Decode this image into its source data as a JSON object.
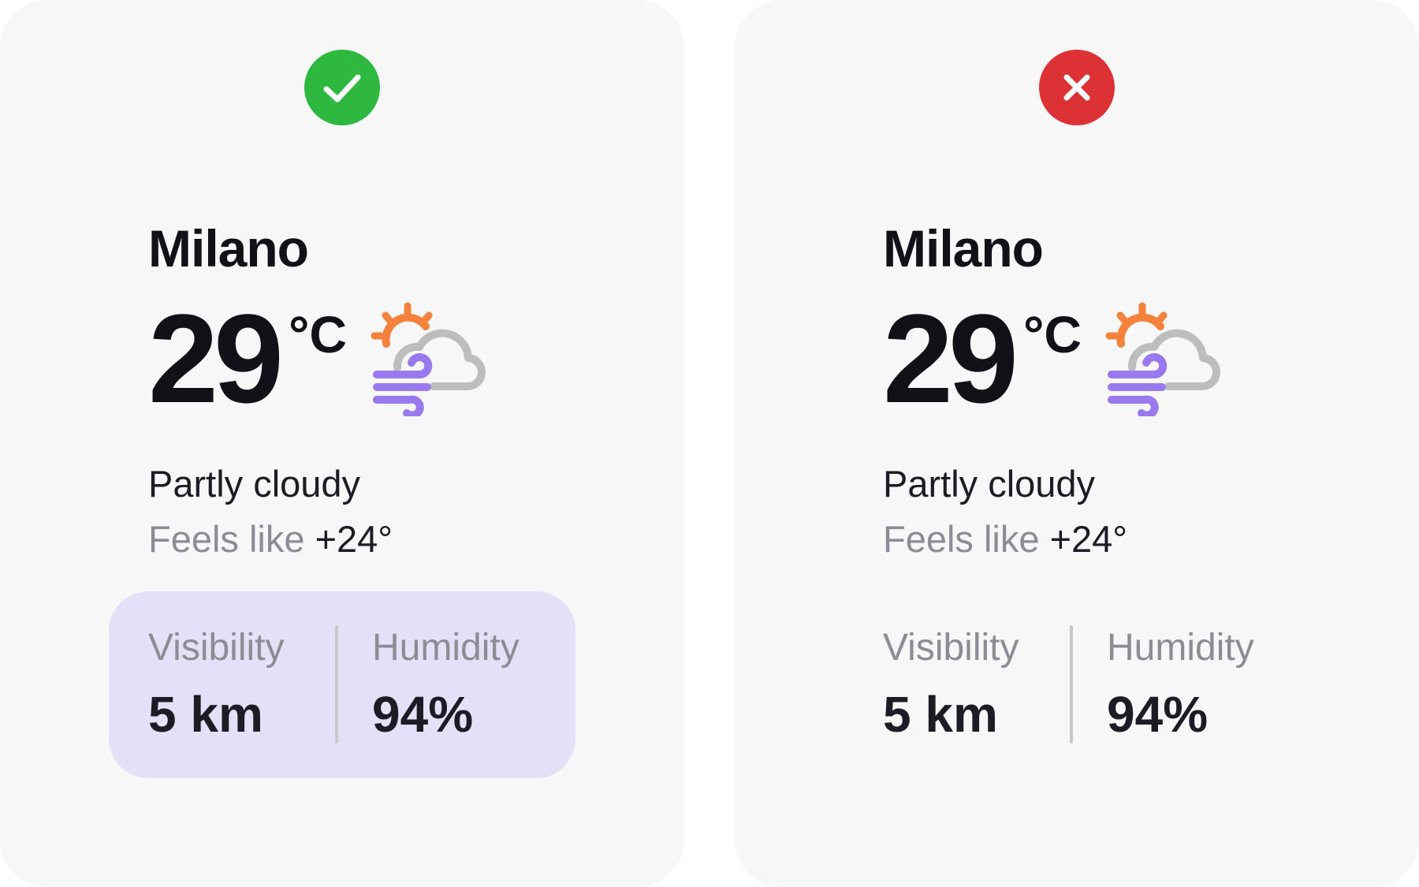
{
  "cards": [
    {
      "verdict": "correct",
      "badge_icon": "checkmark-icon",
      "badge_color": "#2fb83f",
      "city": "Milano",
      "temperature": "29",
      "unit": "°C",
      "weather_icon": "partly-cloudy-windy-icon",
      "condition": "Partly cloudy",
      "feels_like_label": "Feels like",
      "feels_like_value": "+24°",
      "stats_highlight_color": "#e4e0f7",
      "stats": [
        {
          "label": "Visibility",
          "value": "5 km"
        },
        {
          "label": "Humidity",
          "value": "94%"
        }
      ]
    },
    {
      "verdict": "incorrect",
      "badge_icon": "cross-icon",
      "badge_color": "#dc3235",
      "city": "Milano",
      "temperature": "29",
      "unit": "°C",
      "weather_icon": "partly-cloudy-windy-icon",
      "condition": "Partly cloudy",
      "feels_like_label": "Feels like",
      "feels_like_value": "+24°",
      "stats": [
        {
          "label": "Visibility",
          "value": "5 km"
        },
        {
          "label": "Humidity",
          "value": "94%"
        }
      ]
    }
  ],
  "colors": {
    "card_background": "#f7f7f7",
    "sun": "#f5823c",
    "cloud": "#bdbdbd",
    "wind": "#9a78ee",
    "primary_text": "#111218",
    "secondary_text": "#8c8c94"
  }
}
